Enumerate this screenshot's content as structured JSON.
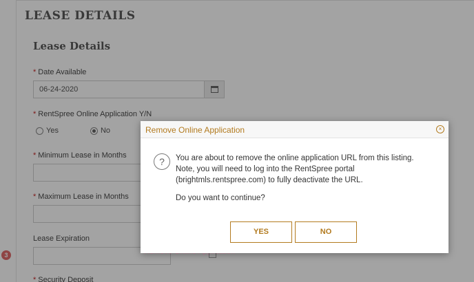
{
  "page": {
    "section_title": "LEASE DETAILS",
    "sub_title": "Lease Details",
    "step_badge": "3"
  },
  "form": {
    "date_available": {
      "label": "Date Available",
      "value": "06-24-2020"
    },
    "online_application": {
      "label": "RentSpree Online Application Y/N",
      "options": [
        "Yes",
        "No"
      ],
      "selected": "No"
    },
    "minimum_lease": {
      "label": "Minimum Lease in Months"
    },
    "maximum_lease": {
      "label": "Maximum Lease in Months"
    },
    "lease_expiration": {
      "label": "Lease Expiration"
    },
    "security_deposit": {
      "label": "Security Deposit"
    }
  },
  "ghost": {
    "text": "Remove Online Application"
  },
  "modal": {
    "title": "Remove Online Application",
    "message": "You are about to remove the online application URL from this listing. Note, you will need to log into the RentSpree portal (brightmls.rentspree.com) to fully deactivate the URL.",
    "question": "Do you want to continue?",
    "yes_label": "YES",
    "no_label": "NO",
    "close_symbol": "×",
    "help_symbol": "?"
  },
  "icons": {
    "close": "close-circle-icon",
    "help": "question-circle-icon",
    "calendar": "calendar-icon"
  },
  "colors": {
    "accent": "#b27a1e",
    "required": "#c62828",
    "overlay": "rgba(0,0,0,0.36)"
  }
}
